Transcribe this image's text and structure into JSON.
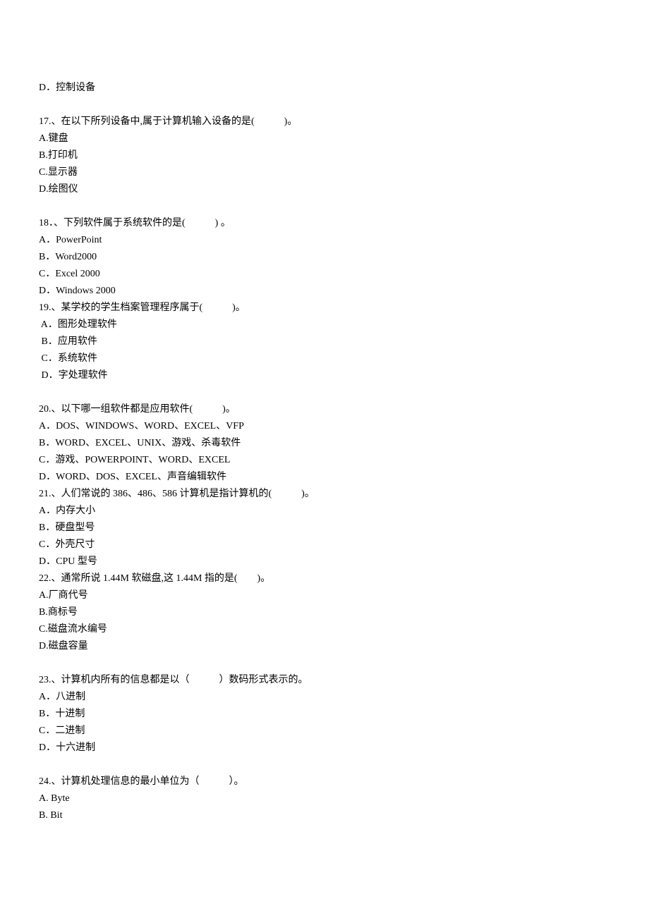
{
  "lines": [
    "D．控制设备",
    "",
    "17.、在以下所列设备中,属于计算机输入设备的是(　　　)。",
    "A.键盘",
    "B.打印机",
    "C.显示器",
    "D.绘图仪",
    "",
    "18．、下列软件属于系统软件的是(　　　) 。",
    "A．PowerPoint",
    "B．Word2000",
    "C．Excel 2000",
    "D．Windows 2000",
    "19.、某学校的学生档案管理程序属于(　　　)。",
    " A．图形处理软件",
    " B．应用软件",
    " C．系统软件",
    " D．字处理软件",
    "",
    "20.、以下哪一组软件都是应用软件(　　　)。",
    "A．DOS、WINDOWS、WORD、EXCEL、VFP",
    "B．WORD、EXCEL、UNIX、游戏、杀毒软件",
    "C．游戏、POWERPOINT、WORD、EXCEL",
    "D．WORD、DOS、EXCEL、声音编辑软件",
    "21.、人们常说的 386、486、586 计算机是指计算机的(　　　)。",
    "A．内存大小",
    "B．硬盘型号",
    "C．外壳尺寸",
    "D．CPU 型号",
    "22.、通常所说 1.44M 软磁盘,这 1.44M 指的是(　　)。",
    "A.厂商代号",
    "B.商标号",
    "C.磁盘流水编号",
    "D.磁盘容量",
    "",
    "23.、计算机内所有的信息都是以（　　　）数码形式表示的。",
    "A．八进制",
    "B．十进制",
    "C．二进制",
    "D．十六进制",
    ""
  ],
  "q24": {
    "question": "24.、计算机处理信息的最小单位为（　　　）。",
    "a": "A. Byte",
    "b": "B. Bit"
  }
}
